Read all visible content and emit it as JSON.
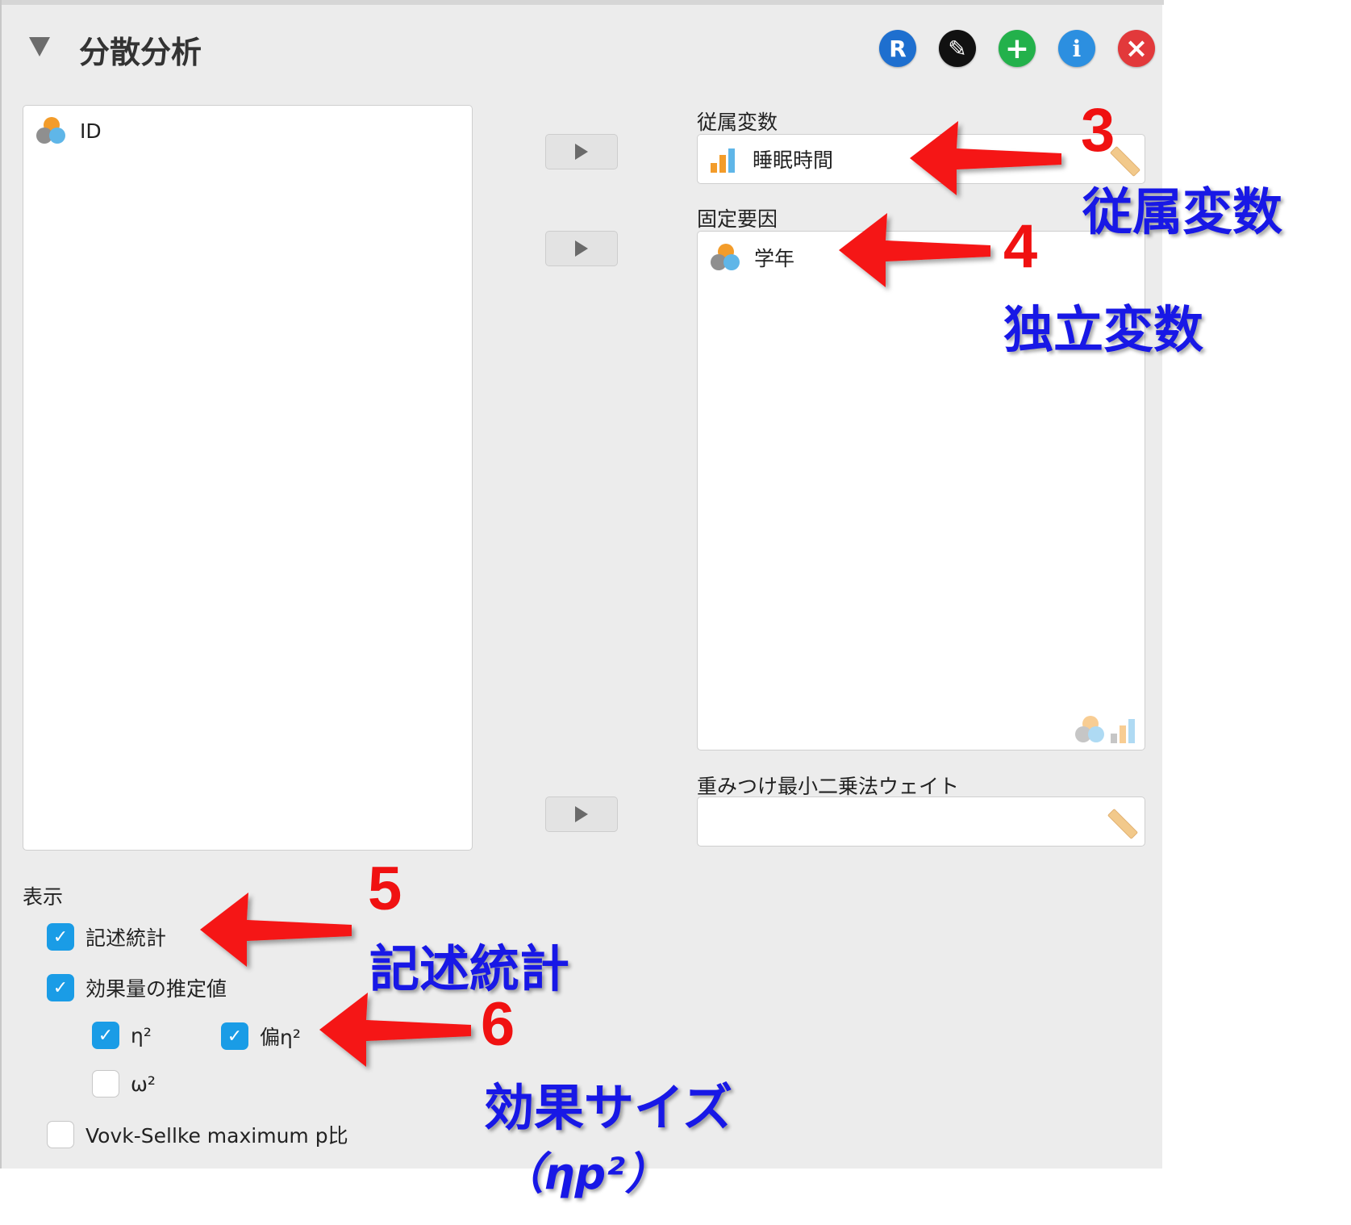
{
  "header": {
    "title": "分散分析",
    "icons": [
      {
        "name": "r-syntax-icon",
        "glyph": "R",
        "color": "#1e6fcf"
      },
      {
        "name": "edit-title-icon",
        "glyph": "✎",
        "color": "#111111"
      },
      {
        "name": "add-analysis-icon",
        "glyph": "+",
        "color": "#23b14b"
      },
      {
        "name": "info-icon",
        "glyph": "i",
        "color": "#2c8fe0"
      },
      {
        "name": "close-analysis-icon",
        "glyph": "×",
        "color": "#e2393b"
      }
    ]
  },
  "source_list": {
    "items": [
      {
        "label": "ID",
        "type": "nominal"
      }
    ]
  },
  "dependent": {
    "label": "従属変数",
    "value": "睡眠時間"
  },
  "fixed_factors": {
    "label": "固定要因",
    "items": [
      "学年"
    ]
  },
  "wls_weights": {
    "label": "重みつけ最小二乗法ウェイト",
    "value": ""
  },
  "display": {
    "label": "表示",
    "descriptives": {
      "label": "記述統計",
      "checked": true
    },
    "effect_size": {
      "label": "効果量の推定値",
      "checked": true
    },
    "eta_sq": {
      "label": "η²",
      "checked": true
    },
    "partial_eta_sq": {
      "label": "偏η²",
      "checked": true
    },
    "omega_sq": {
      "label": "ω²",
      "checked": false
    },
    "vovk_sellke": {
      "label": "Vovk-Sellke maximum p比",
      "checked": false
    }
  },
  "annotations": {
    "a3": {
      "number": "3",
      "text": "従属変数"
    },
    "a4": {
      "number": "4",
      "text": "独立変数"
    },
    "a5": {
      "number": "5",
      "text": "記述統計"
    },
    "a6": {
      "number": "6",
      "text": "効果サイズ",
      "sub": "（ηp²）"
    }
  },
  "colors": {
    "accent_checkbox": "#1a9ce6",
    "annotation_number": "#f01111",
    "annotation_text": "#1818e6"
  }
}
